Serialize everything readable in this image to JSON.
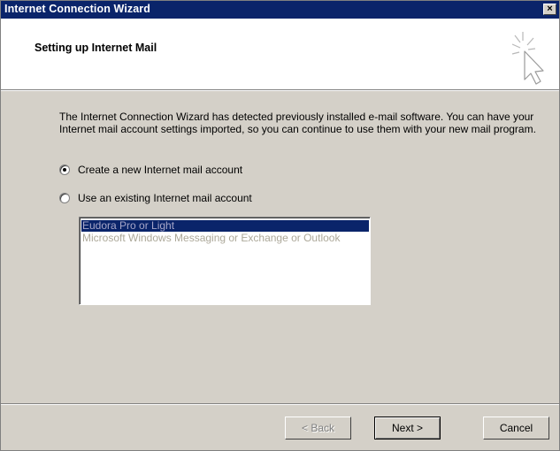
{
  "window": {
    "title": "Internet Connection Wizard",
    "close_glyph": "×"
  },
  "header": {
    "title": "Setting up Internet Mail",
    "icon": "pointer-cursor-sparkle-icon"
  },
  "body": {
    "description": "The Internet Connection Wizard has detected previously installed e-mail software. You can have your Internet mail account settings imported, so you can continue to use them with your new mail program.",
    "options": [
      {
        "label": "Create a new Internet mail account",
        "selected": true
      },
      {
        "label": "Use an existing Internet mail account",
        "selected": false
      }
    ],
    "list": {
      "enabled": false,
      "items": [
        {
          "label": "Eudora Pro or Light",
          "selected": true
        },
        {
          "label": "Microsoft Windows Messaging or Exchange or Outlook",
          "selected": false
        }
      ]
    }
  },
  "footer": {
    "back_label": "< Back",
    "next_label": "Next >",
    "cancel_label": "Cancel"
  },
  "colors": {
    "titlebar": "#0a246a",
    "dialog_face": "#d4d0c8",
    "header_bg": "#ffffff",
    "selection": "#0a246a",
    "disabled_text": "#aca899"
  }
}
